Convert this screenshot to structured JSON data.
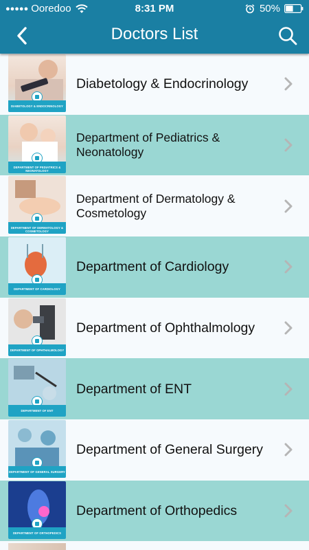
{
  "status_bar": {
    "signal_dots": "●●●●●",
    "carrier": "Ooredoo",
    "time": "8:31 PM",
    "battery_percent": "50%",
    "battery_level": 0.5
  },
  "nav": {
    "title": "Doctors List",
    "back_icon": "chevron-left-icon",
    "search_icon": "search-icon"
  },
  "colors": {
    "header": "#1a7fa3",
    "row_light": "#f6fafd",
    "row_teal": "#9ad7d3",
    "thumb_band": "#1fa3c4",
    "chevron": "#b5b5b5"
  },
  "departments": [
    {
      "label": "Diabetology & Endocrinology",
      "thumb_caption": "DIABETOLOGY & ENDOCRINOLOGY"
    },
    {
      "label": "Department of Pediatrics & Neonatology",
      "thumb_caption": "DEPARTMENT OF PEDIATRICS & NEONATOLOGY"
    },
    {
      "label": "Department of Dermatology & Cosmetology",
      "thumb_caption": "DEPARTMENT OF DERMATOLOGY & COSMETOLOGY"
    },
    {
      "label": "Department of Cardiology",
      "thumb_caption": "DEPARTMENT OF CARDIOLOGY"
    },
    {
      "label": "Department of Ophthalmology",
      "thumb_caption": "DEPARTMENT OF OPHTHALMOLOGY"
    },
    {
      "label": "Department of ENT",
      "thumb_caption": "DEPARTMENT OF ENT"
    },
    {
      "label": "Department of General Surgery",
      "thumb_caption": "DEPARTMENT OF GENERAL SURGERY"
    },
    {
      "label": "Department of Orthopedics",
      "thumb_caption": "DEPARTMENT OF ORTHOPEDICS"
    }
  ]
}
